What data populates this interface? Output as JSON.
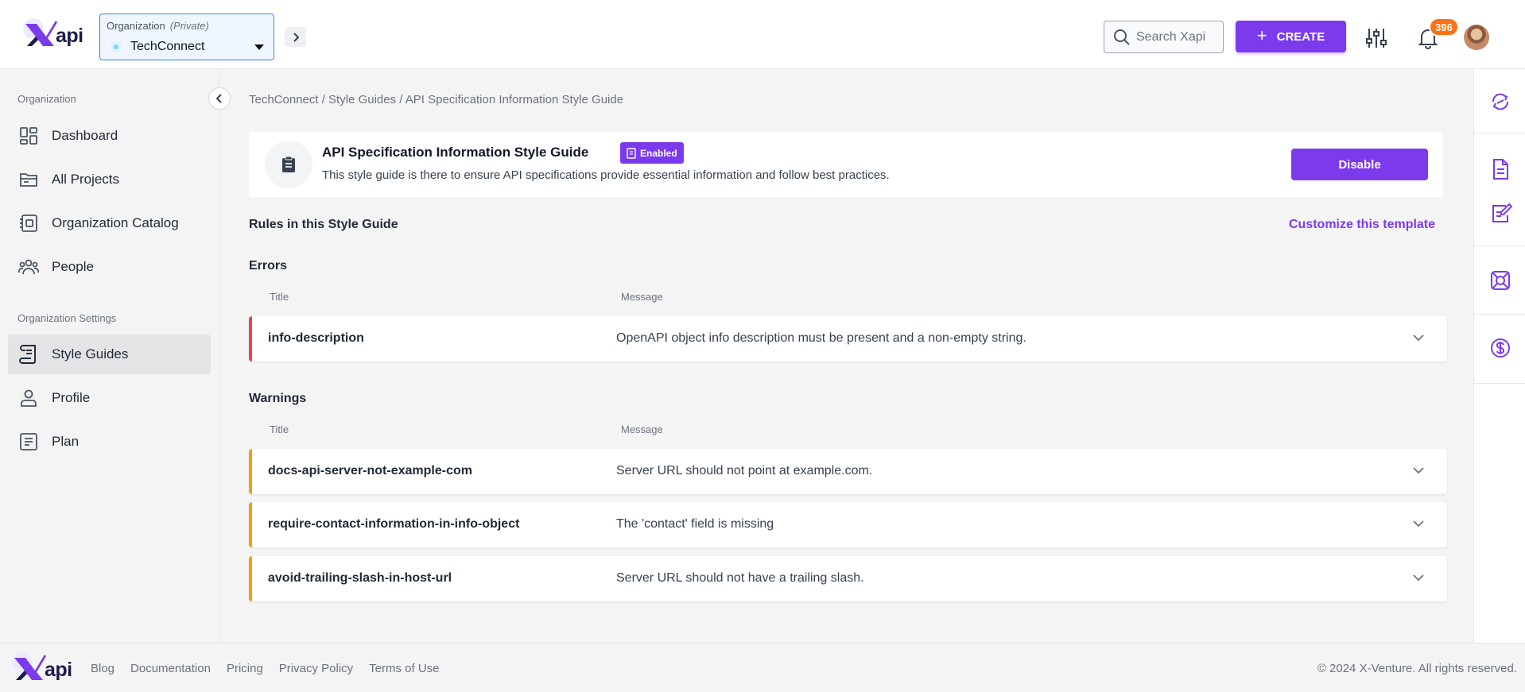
{
  "brand": {
    "logo_text": "api",
    "accent": "#7c3aed"
  },
  "header": {
    "org_caption": "Organization",
    "org_privacy": "(Private)",
    "org_name": "TechConnect",
    "search_placeholder": "Search Xapi",
    "create_label": "CREATE",
    "notification_count": "396"
  },
  "sidebar": {
    "section1": "Organization",
    "section2": "Organization Settings",
    "items": [
      {
        "label": "Dashboard",
        "icon": "dashboard-icon"
      },
      {
        "label": "All Projects",
        "icon": "folder-icon"
      },
      {
        "label": "Organization Catalog",
        "icon": "catalog-icon"
      },
      {
        "label": "People",
        "icon": "people-icon"
      },
      {
        "label": "Style Guides",
        "icon": "style-guide-icon",
        "active": true
      },
      {
        "label": "Profile",
        "icon": "profile-icon"
      },
      {
        "label": "Plan",
        "icon": "plan-icon"
      }
    ]
  },
  "main": {
    "breadcrumb": "TechConnect / Style Guides / API Specification Information Style Guide",
    "guide": {
      "title": "API Specification Information Style Guide",
      "status": "Enabled",
      "description": "This style guide is there to ensure API specifications provide essential information and follow best practices.",
      "disable_label": "Disable"
    },
    "rules_heading": "Rules in this Style Guide",
    "customize_label": "Customize this template",
    "col_title": "Title",
    "col_message": "Message",
    "errors": {
      "heading": "Errors",
      "rows": [
        {
          "title": "info-description",
          "message": "OpenAPI object info description must be present and a non-empty string."
        }
      ]
    },
    "warnings": {
      "heading": "Warnings",
      "rows": [
        {
          "title": "docs-api-server-not-example-com",
          "message": "Server URL should not point at example.com."
        },
        {
          "title": "require-contact-information-in-info-object",
          "message": "The 'contact' field is missing"
        },
        {
          "title": "avoid-trailing-slash-in-host-url",
          "message": "Server URL should not have a trailing slash."
        }
      ]
    }
  },
  "footer": {
    "links": [
      "Blog",
      "Documentation",
      "Pricing",
      "Privacy Policy",
      "Terms of Use"
    ],
    "copyright": "© 2024 X-Venture. All rights reserved."
  }
}
